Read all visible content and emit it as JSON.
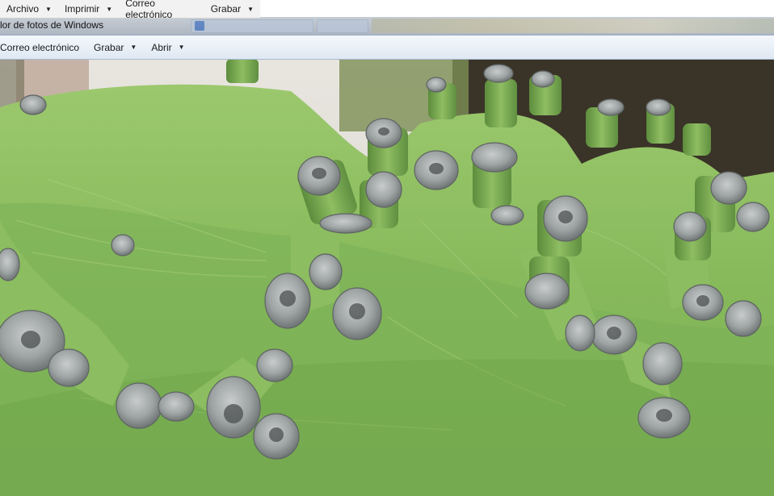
{
  "top_menu": {
    "items": [
      {
        "label": "Archivo"
      },
      {
        "label": "Imprimir"
      },
      {
        "label": "Correo electrónico"
      },
      {
        "label": "Grabar"
      }
    ]
  },
  "window": {
    "title": "lor de fotos de Windows"
  },
  "toolbar": {
    "items": [
      {
        "label": "Correo electrónico",
        "has_menu": false
      },
      {
        "label": "Grabar",
        "has_menu": true
      },
      {
        "label": "Abrir",
        "has_menu": true
      }
    ]
  },
  "photo": {
    "subject": "cactus-closeup",
    "colors": {
      "cactus": "#8fbf62",
      "sky": "#e7e4df",
      "soil": "#3a3328"
    }
  }
}
